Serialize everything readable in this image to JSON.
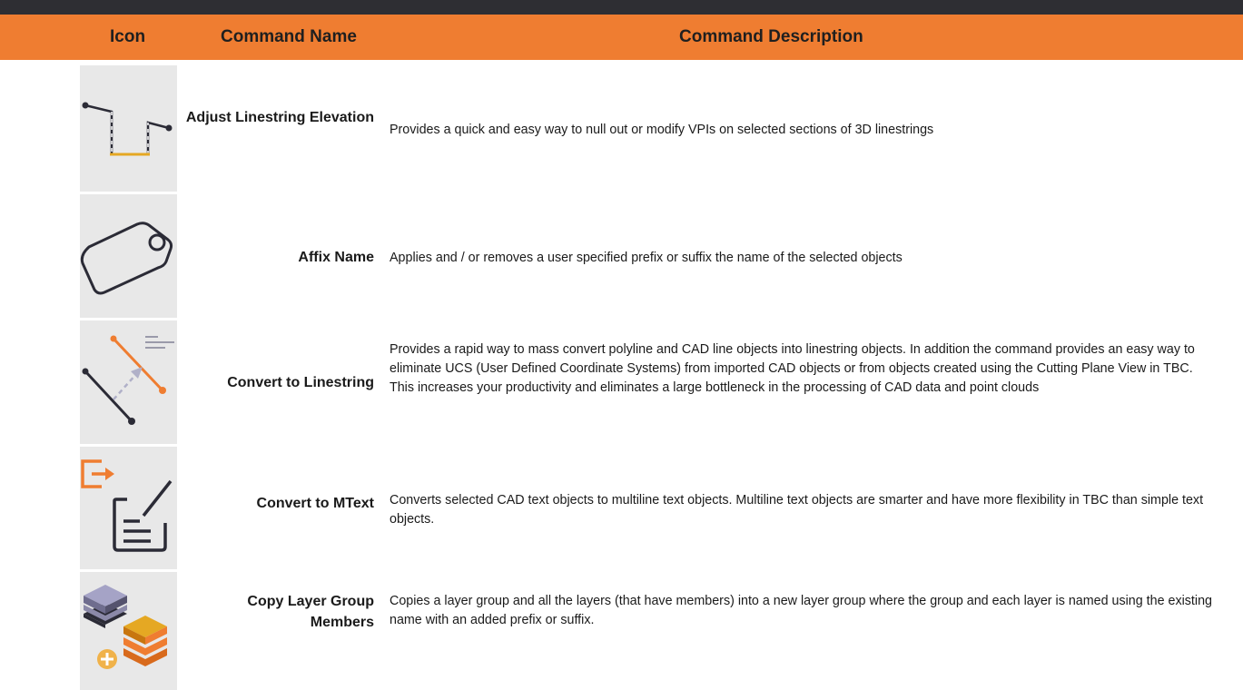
{
  "header": {
    "icon": "Icon",
    "name": "Command Name",
    "description": "Command Description"
  },
  "colors": {
    "top_bar": "#2e2e33",
    "header_bg": "#ef7d31",
    "icon_cell_bg": "#e8e8e8",
    "accent_orange": "#ef7d31",
    "accent_gold": "#e5a823",
    "icon_dark": "#2b2b36"
  },
  "rows": [
    {
      "icon": "adjust-linestring-elevation-icon",
      "name": "Adjust Linestring Elevation",
      "description": "Provides a quick and easy way to null out or modify VPIs on selected sections of 3D linestrings"
    },
    {
      "icon": "affix-name-tag-icon",
      "name": "Affix Name",
      "description": "Applies and / or removes a user specified prefix or suffix the name of the selected objects"
    },
    {
      "icon": "convert-to-linestring-icon",
      "name": "Convert to Linestring",
      "description": "Provides a rapid way to mass convert polyline and CAD line objects into linestring objects. In addition the command provides an easy way to eliminate UCS (User Defined Coordinate Systems) from imported CAD objects or from objects created using the Cutting Plane View in TBC. This increases your productivity and eliminates a large bottleneck in the processing of CAD data and point clouds"
    },
    {
      "icon": "convert-to-mtext-icon",
      "name": "Convert to MText",
      "description": "Converts selected CAD text objects to multiline text objects. Multiline text objects are smarter and have more flexibility in TBC than simple text objects."
    },
    {
      "icon": "copy-layer-group-members-icon",
      "name": "Copy Layer Group Members",
      "description": "Copies a layer group and all the layers (that have members) into a new layer group where the group and each layer is named using the existing name with an added prefix or suffix."
    }
  ]
}
